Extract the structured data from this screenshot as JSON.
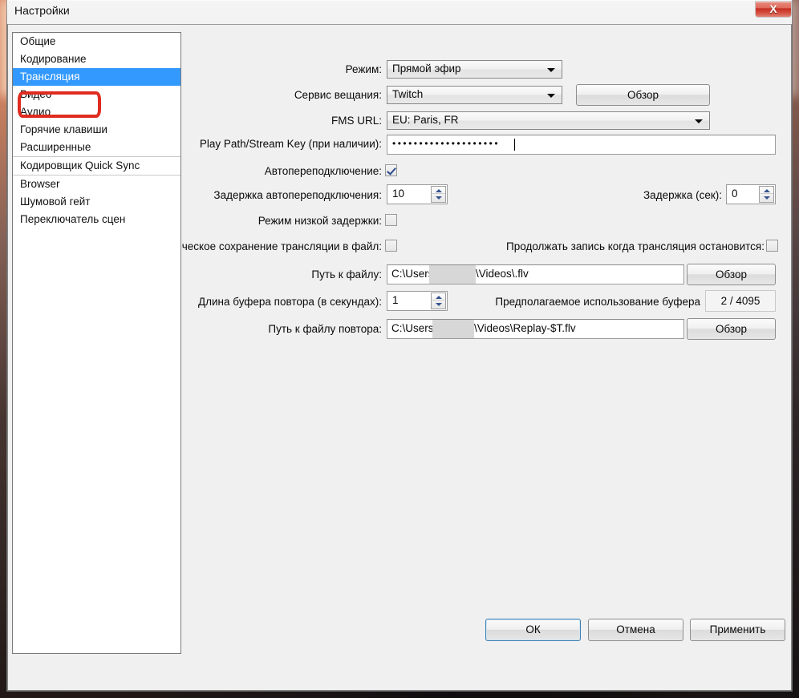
{
  "window": {
    "title": "Настройки",
    "close_label": "X",
    "close_icon": "close-icon"
  },
  "sidebar": {
    "items": [
      {
        "label": "Общие",
        "selected": false
      },
      {
        "label": "Кодирование",
        "selected": false
      },
      {
        "label": "Трансляция",
        "selected": true
      },
      {
        "label": "Видео",
        "selected": false
      },
      {
        "label": "Аудио",
        "selected": false
      },
      {
        "label": "Горячие клавиши",
        "selected": false
      },
      {
        "label": "Расширенные",
        "selected": false
      },
      {
        "label": "Кодировщик Quick Sync",
        "selected": false
      },
      {
        "label": "Browser",
        "selected": false
      },
      {
        "label": "Шумовой гейт",
        "selected": false
      },
      {
        "label": "Переключатель сцен",
        "selected": false
      }
    ],
    "annotation_color": "#e02b20"
  },
  "form": {
    "mode_label": "Режим:",
    "mode_value": "Прямой эфир",
    "service_label": "Сервис вещания:",
    "service_value": "Twitch",
    "service_browse": "Обзор",
    "fms_label": "FMS URL:",
    "fms_value": "EU: Paris, FR",
    "streamkey_label": "Play Path/Stream Key (при наличии):",
    "streamkey_value": "••••••••••••••••••••",
    "autoreconnect_label": "Автопереподключение:",
    "autoreconnect_checked": true,
    "reconnect_delay_label": "Задержка автопереподключения:",
    "reconnect_delay_value": "10",
    "delay_sec_label": "Задержка (сек):",
    "delay_sec_value": "0",
    "lowlatency_label": "Режим низкой задержки:",
    "lowlatency_checked": false,
    "autosave_label": "ческое сохранение трансляции в файл:",
    "autosave_checked": false,
    "keeprecording_label": "Продолжать запись когда трансляция остановится:",
    "keeprecording_checked": false,
    "filepath_label": "Путь к файлу:",
    "filepath_prefix": "C:\\Users",
    "filepath_suffix": "\\Videos\\.flv",
    "filepath_browse": "Обзор",
    "replaybuffer_label": "Длина буфера повтора (в секундах):",
    "replaybuffer_value": "1",
    "bufferusage_label": "Предполагаемое использование буфера",
    "bufferusage_value": "2 / 4095",
    "replaypath_label": "Путь к файлу повтора:",
    "replaypath_prefix": "C:\\Users",
    "replaypath_suffix": "\\Videos\\Replay-$T.flv",
    "replaypath_browse": "Обзор"
  },
  "footer": {
    "ok": "ОК",
    "cancel": "Отмена",
    "apply": "Применить"
  }
}
